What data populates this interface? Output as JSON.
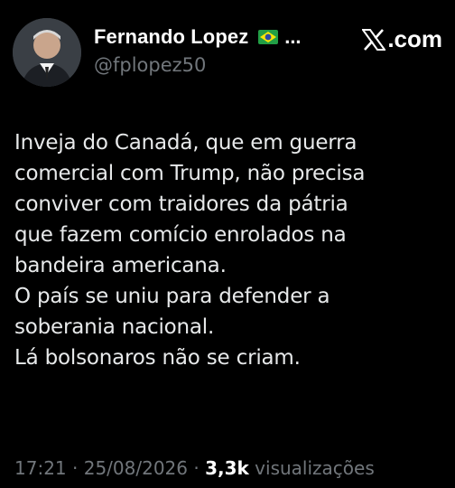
{
  "header": {
    "display_name": "Fernando Lopez",
    "name_truncation": "...",
    "handle": "@fplopez50",
    "brand_label": ".com",
    "flag_icon": "brazil-flag-icon"
  },
  "tweet": {
    "text": "Inveja do Canadá,  que em guerra\ncomercial com Trump, não precisa\nconviver com traidores da pátria\nque fazem comício enrolados na\nbandeira americana.\nO país se uniu para defender a\nsoberania nacional.\nLá bolsonaros não se criam."
  },
  "meta": {
    "time": "17:21",
    "separator": "·",
    "date": "25/08/2026",
    "views_count": "3,3k",
    "views_label": "visualizações"
  },
  "colors": {
    "background": "#000000",
    "text": "#e7e9ea",
    "muted": "#71767b",
    "white": "#ffffff"
  }
}
